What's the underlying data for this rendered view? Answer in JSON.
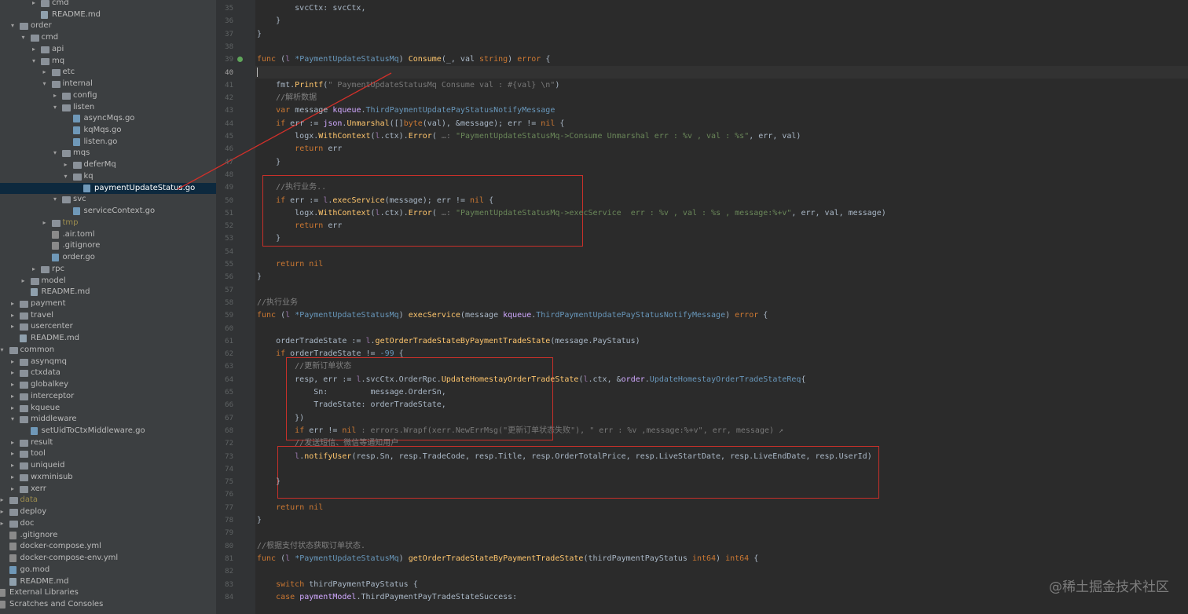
{
  "tree": [
    {
      "depth": 2,
      "arrow": "▸",
      "icon": "folder",
      "label": "cmd"
    },
    {
      "depth": 2,
      "arrow": "",
      "icon": "md",
      "label": "README.md"
    },
    {
      "depth": 0,
      "arrow": "▾",
      "icon": "folder",
      "label": "order"
    },
    {
      "depth": 1,
      "arrow": "▾",
      "icon": "folder",
      "label": "cmd"
    },
    {
      "depth": 2,
      "arrow": "▸",
      "icon": "folder",
      "label": "api"
    },
    {
      "depth": 2,
      "arrow": "▾",
      "icon": "folder",
      "label": "mq"
    },
    {
      "depth": 3,
      "arrow": "▸",
      "icon": "folder",
      "label": "etc"
    },
    {
      "depth": 3,
      "arrow": "▾",
      "icon": "folder",
      "label": "internal"
    },
    {
      "depth": 4,
      "arrow": "▸",
      "icon": "folder",
      "label": "config"
    },
    {
      "depth": 4,
      "arrow": "▾",
      "icon": "folder",
      "label": "listen"
    },
    {
      "depth": 5,
      "arrow": "",
      "icon": "file",
      "label": "asyncMqs.go"
    },
    {
      "depth": 5,
      "arrow": "",
      "icon": "file",
      "label": "kqMqs.go"
    },
    {
      "depth": 5,
      "arrow": "",
      "icon": "file",
      "label": "listen.go"
    },
    {
      "depth": 4,
      "arrow": "▾",
      "icon": "folder",
      "label": "mqs"
    },
    {
      "depth": 5,
      "arrow": "▸",
      "icon": "folder",
      "label": "deferMq"
    },
    {
      "depth": 5,
      "arrow": "▾",
      "icon": "folder",
      "label": "kq"
    },
    {
      "depth": 6,
      "arrow": "",
      "icon": "file",
      "label": "paymentUpdateStatus.go",
      "selected": true
    },
    {
      "depth": 4,
      "arrow": "▾",
      "icon": "folder",
      "label": "svc"
    },
    {
      "depth": 5,
      "arrow": "",
      "icon": "file",
      "label": "serviceContext.go"
    },
    {
      "depth": 3,
      "arrow": "▸",
      "icon": "folder",
      "label": "tmp",
      "dim": true
    },
    {
      "depth": 3,
      "arrow": "",
      "icon": "misc",
      "label": ".air.toml"
    },
    {
      "depth": 3,
      "arrow": "",
      "icon": "misc",
      "label": ".gitignore"
    },
    {
      "depth": 3,
      "arrow": "",
      "icon": "file",
      "label": "order.go"
    },
    {
      "depth": 2,
      "arrow": "▸",
      "icon": "folder",
      "label": "rpc"
    },
    {
      "depth": 1,
      "arrow": "▸",
      "icon": "folder",
      "label": "model"
    },
    {
      "depth": 1,
      "arrow": "",
      "icon": "md",
      "label": "README.md"
    },
    {
      "depth": 0,
      "arrow": "▸",
      "icon": "folder",
      "label": "payment"
    },
    {
      "depth": 0,
      "arrow": "▸",
      "icon": "folder",
      "label": "travel"
    },
    {
      "depth": 0,
      "arrow": "▸",
      "icon": "folder",
      "label": "usercenter"
    },
    {
      "depth": 0,
      "arrow": "",
      "icon": "md",
      "label": "README.md"
    },
    {
      "depth": -1,
      "arrow": "▾",
      "icon": "folder",
      "label": "common"
    },
    {
      "depth": 0,
      "arrow": "▸",
      "icon": "folder",
      "label": "asynqmq"
    },
    {
      "depth": 0,
      "arrow": "▸",
      "icon": "folder",
      "label": "ctxdata"
    },
    {
      "depth": 0,
      "arrow": "▸",
      "icon": "folder",
      "label": "globalkey"
    },
    {
      "depth": 0,
      "arrow": "▸",
      "icon": "folder",
      "label": "interceptor"
    },
    {
      "depth": 0,
      "arrow": "▸",
      "icon": "folder",
      "label": "kqueue"
    },
    {
      "depth": 0,
      "arrow": "▾",
      "icon": "folder",
      "label": "middleware"
    },
    {
      "depth": 1,
      "arrow": "",
      "icon": "file",
      "label": "setUidToCtxMiddleware.go"
    },
    {
      "depth": 0,
      "arrow": "▸",
      "icon": "folder",
      "label": "result"
    },
    {
      "depth": 0,
      "arrow": "▸",
      "icon": "folder",
      "label": "tool"
    },
    {
      "depth": 0,
      "arrow": "▸",
      "icon": "folder",
      "label": "uniqueid"
    },
    {
      "depth": 0,
      "arrow": "▸",
      "icon": "folder",
      "label": "wxminisub"
    },
    {
      "depth": 0,
      "arrow": "▸",
      "icon": "folder",
      "label": "xerr"
    },
    {
      "depth": -1,
      "arrow": "▸",
      "icon": "folder",
      "label": "data",
      "dim": true
    },
    {
      "depth": -1,
      "arrow": "▸",
      "icon": "folder",
      "label": "deploy"
    },
    {
      "depth": -1,
      "arrow": "▸",
      "icon": "folder",
      "label": "doc"
    },
    {
      "depth": -1,
      "arrow": "",
      "icon": "misc",
      "label": ".gitignore"
    },
    {
      "depth": -1,
      "arrow": "",
      "icon": "misc",
      "label": "docker-compose.yml"
    },
    {
      "depth": -1,
      "arrow": "",
      "icon": "misc",
      "label": "docker-compose-env.yml"
    },
    {
      "depth": -1,
      "arrow": "",
      "icon": "file",
      "label": "go.mod"
    },
    {
      "depth": -1,
      "arrow": "",
      "icon": "md",
      "label": "README.md"
    },
    {
      "depth": -2,
      "arrow": "▸",
      "icon": "misc",
      "label": "External Libraries"
    },
    {
      "depth": -2,
      "arrow": "",
      "icon": "misc",
      "label": "Scratches and Consoles"
    }
  ],
  "code": [
    {
      "n": "35",
      "s": [
        [
          "        svcCtx: svcCtx,",
          "t"
        ]
      ]
    },
    {
      "n": "36",
      "s": [
        [
          "    }",
          "t"
        ]
      ]
    },
    {
      "n": "37",
      "s": [
        [
          "}",
          "t"
        ]
      ]
    },
    {
      "n": "38",
      "s": []
    },
    {
      "n": "39",
      "s": [
        [
          "func ",
          "k"
        ],
        [
          "(",
          "t"
        ],
        [
          "l ",
          "v"
        ],
        [
          "*PaymentUpdateStatusMq",
          "ty"
        ],
        [
          ") ",
          "t"
        ],
        [
          "Consume",
          "fn"
        ],
        [
          "(_, val ",
          "t"
        ],
        [
          "string",
          "k"
        ],
        [
          ") ",
          "t"
        ],
        [
          "error",
          "k"
        ],
        [
          " {",
          "t"
        ]
      ]
    },
    {
      "n": "40",
      "s": [],
      "cur": true
    },
    {
      "n": "41",
      "s": [
        [
          "    fmt.",
          "t"
        ],
        [
          "Printf",
          "fc"
        ],
        [
          "(",
          "t"
        ],
        [
          "\" PaymentUpdateStatusMq Consume val : #{val} \\n\"",
          "hint"
        ],
        [
          ")",
          "t"
        ]
      ]
    },
    {
      "n": "42",
      "s": [
        [
          "    //解析数据",
          "c"
        ]
      ]
    },
    {
      "n": "43",
      "s": [
        [
          "    ",
          "t"
        ],
        [
          "var ",
          "k"
        ],
        [
          "message ",
          "t"
        ],
        [
          "kqueue",
          "pk"
        ],
        [
          ".",
          "t"
        ],
        [
          "ThirdPaymentUpdatePayStatusNotifyMessage",
          "ty"
        ]
      ]
    },
    {
      "n": "44",
      "s": [
        [
          "    ",
          "t"
        ],
        [
          "if ",
          "k"
        ],
        [
          "err := ",
          "t"
        ],
        [
          "json",
          "pk"
        ],
        [
          ".",
          "t"
        ],
        [
          "Unmarshal",
          "fc"
        ],
        [
          "([]",
          "t"
        ],
        [
          "byte",
          "k"
        ],
        [
          "(val), &message); err != ",
          "t"
        ],
        [
          "nil",
          "k"
        ],
        [
          " {",
          "t"
        ]
      ]
    },
    {
      "n": "45",
      "s": [
        [
          "        logx.",
          "t"
        ],
        [
          "WithContext",
          "fc"
        ],
        [
          "(",
          "t"
        ],
        [
          "l",
          "v"
        ],
        [
          ".ctx).",
          "t"
        ],
        [
          "Error",
          "fc"
        ],
        [
          "( ",
          "t"
        ],
        [
          "…:",
          "hint"
        ],
        [
          " ",
          "t"
        ],
        [
          "\"PaymentUpdateStatusMq->Consume Unmarshal err : %v , val : %s\"",
          "s"
        ],
        [
          ", err, val)",
          "t"
        ]
      ]
    },
    {
      "n": "46",
      "s": [
        [
          "        ",
          "t"
        ],
        [
          "return ",
          "k"
        ],
        [
          "err",
          "t"
        ]
      ]
    },
    {
      "n": "47",
      "s": [
        [
          "    }",
          "t"
        ]
      ]
    },
    {
      "n": "48",
      "s": []
    },
    {
      "n": "49",
      "s": [
        [
          "    //执行业务..",
          "c"
        ]
      ]
    },
    {
      "n": "50",
      "s": [
        [
          "    ",
          "t"
        ],
        [
          "if ",
          "k"
        ],
        [
          "err := ",
          "t"
        ],
        [
          "l",
          "v"
        ],
        [
          ".",
          "t"
        ],
        [
          "execService",
          "fc"
        ],
        [
          "(message); err != ",
          "t"
        ],
        [
          "nil",
          "k"
        ],
        [
          " {",
          "t"
        ]
      ]
    },
    {
      "n": "51",
      "s": [
        [
          "        logx.",
          "t"
        ],
        [
          "WithContext",
          "fc"
        ],
        [
          "(",
          "t"
        ],
        [
          "l",
          "v"
        ],
        [
          ".ctx).",
          "t"
        ],
        [
          "Error",
          "fc"
        ],
        [
          "( ",
          "t"
        ],
        [
          "…:",
          "hint"
        ],
        [
          " ",
          "t"
        ],
        [
          "\"PaymentUpdateStatusMq->execService  err : %v , val : %s , message:%+v\"",
          "s"
        ],
        [
          ", err, val, message)",
          "t"
        ]
      ]
    },
    {
      "n": "52",
      "s": [
        [
          "        ",
          "t"
        ],
        [
          "return ",
          "k"
        ],
        [
          "err",
          "t"
        ]
      ]
    },
    {
      "n": "53",
      "s": [
        [
          "    }",
          "t"
        ]
      ]
    },
    {
      "n": "54",
      "s": []
    },
    {
      "n": "55",
      "s": [
        [
          "    ",
          "t"
        ],
        [
          "return ",
          "k"
        ],
        [
          "nil",
          "k"
        ]
      ]
    },
    {
      "n": "56",
      "s": [
        [
          "}",
          "t"
        ]
      ]
    },
    {
      "n": "57",
      "s": []
    },
    {
      "n": "58",
      "s": [
        [
          "//执行业务",
          "c"
        ]
      ]
    },
    {
      "n": "59",
      "s": [
        [
          "func ",
          "k"
        ],
        [
          "(",
          "t"
        ],
        [
          "l ",
          "v"
        ],
        [
          "*PaymentUpdateStatusMq",
          "ty"
        ],
        [
          ") ",
          "t"
        ],
        [
          "execService",
          "fn"
        ],
        [
          "(message ",
          "t"
        ],
        [
          "kqueue",
          "pk"
        ],
        [
          ".",
          "t"
        ],
        [
          "ThirdPaymentUpdatePayStatusNotifyMessage",
          "ty"
        ],
        [
          ") ",
          "t"
        ],
        [
          "error",
          "k"
        ],
        [
          " {",
          "t"
        ]
      ]
    },
    {
      "n": "60",
      "s": []
    },
    {
      "n": "61",
      "s": [
        [
          "    orderTradeState := ",
          "t"
        ],
        [
          "l",
          "v"
        ],
        [
          ".",
          "t"
        ],
        [
          "getOrderTradeStateByPaymentTradeState",
          "fc"
        ],
        [
          "(message.PayStatus)",
          "t"
        ]
      ]
    },
    {
      "n": "62",
      "s": [
        [
          "    ",
          "t"
        ],
        [
          "if ",
          "k"
        ],
        [
          "orderTradeState != ",
          "t"
        ],
        [
          "-99",
          "num"
        ],
        [
          " {",
          "t"
        ]
      ]
    },
    {
      "n": "63",
      "s": [
        [
          "        //更新订单状态",
          "c"
        ]
      ]
    },
    {
      "n": "64",
      "s": [
        [
          "        resp, err := ",
          "t"
        ],
        [
          "l",
          "v"
        ],
        [
          ".svcCtx.OrderRpc.",
          "t"
        ],
        [
          "UpdateHomestayOrderTradeState",
          "fc"
        ],
        [
          "(",
          "t"
        ],
        [
          "l",
          "v"
        ],
        [
          ".ctx, &",
          "t"
        ],
        [
          "order",
          "pk"
        ],
        [
          ".",
          "t"
        ],
        [
          "UpdateHomestayOrderTradeStateReq",
          "ty"
        ],
        [
          "{",
          "t"
        ]
      ]
    },
    {
      "n": "65",
      "s": [
        [
          "            Sn:         message.OrderSn,",
          "t"
        ]
      ]
    },
    {
      "n": "66",
      "s": [
        [
          "            TradeState: orderTradeState,",
          "t"
        ]
      ]
    },
    {
      "n": "67",
      "s": [
        [
          "        })",
          "t"
        ]
      ]
    },
    {
      "n": "68",
      "s": [
        [
          "        ",
          "t"
        ],
        [
          "if ",
          "k"
        ],
        [
          "err != ",
          "t"
        ],
        [
          "nil",
          "k"
        ],
        [
          " ",
          "t"
        ],
        [
          ": errors.Wrapf(xerr.NewErrMsg(\"更新订单状态失败\"), \" err : %v ,message:%+v\", err, message) ↗",
          "hint"
        ]
      ]
    },
    {
      "n": "72",
      "s": [
        [
          "        //发送短信、微信等通知用户",
          "c"
        ]
      ]
    },
    {
      "n": "73",
      "s": [
        [
          "        ",
          "t"
        ],
        [
          "l",
          "v"
        ],
        [
          ".",
          "t"
        ],
        [
          "notifyUser",
          "fc"
        ],
        [
          "(resp.Sn, resp.TradeCode, resp.Title, resp.OrderTotalPrice, resp.LiveStartDate, resp.LiveEndDate, resp.UserId)",
          "t"
        ]
      ]
    },
    {
      "n": "74",
      "s": []
    },
    {
      "n": "75",
      "s": [
        [
          "    }",
          "t"
        ]
      ]
    },
    {
      "n": "76",
      "s": []
    },
    {
      "n": "77",
      "s": [
        [
          "    ",
          "t"
        ],
        [
          "return ",
          "k"
        ],
        [
          "nil",
          "k"
        ]
      ]
    },
    {
      "n": "78",
      "s": [
        [
          "}",
          "t"
        ]
      ]
    },
    {
      "n": "79",
      "s": []
    },
    {
      "n": "80",
      "s": [
        [
          "//根据支付状态获取订单状态.",
          "c"
        ]
      ]
    },
    {
      "n": "81",
      "s": [
        [
          "func ",
          "k"
        ],
        [
          "(",
          "t"
        ],
        [
          "l ",
          "v"
        ],
        [
          "*PaymentUpdateStatusMq",
          "ty"
        ],
        [
          ") ",
          "t"
        ],
        [
          "getOrderTradeStateByPaymentTradeState",
          "fn"
        ],
        [
          "(thirdPaymentPayStatus ",
          "t"
        ],
        [
          "int64",
          "k"
        ],
        [
          ") ",
          "t"
        ],
        [
          "int64",
          "k"
        ],
        [
          " {",
          "t"
        ]
      ]
    },
    {
      "n": "82",
      "s": []
    },
    {
      "n": "83",
      "s": [
        [
          "    ",
          "t"
        ],
        [
          "switch ",
          "k"
        ],
        [
          "thirdPaymentPayStatus {",
          "t"
        ]
      ]
    },
    {
      "n": "84",
      "s": [
        [
          "    ",
          "t"
        ],
        [
          "case ",
          "k"
        ],
        [
          "paymentModel",
          "pk"
        ],
        [
          ".ThirdPaymentPayTradeStateSuccess:",
          "t"
        ]
      ]
    }
  ],
  "colors": {
    "t": "#a9b7c6",
    "k": "#cc7832",
    "c": "#808080",
    "s": "#6a8759",
    "fn": "#ffc66d",
    "fc": "#ffc66d",
    "ty": "#6897bb",
    "v": "#9876aa",
    "pk": "#d0a8ff",
    "num": "#6897bb",
    "hint": "#787878"
  },
  "watermark": "@稀土掘金技术社区"
}
